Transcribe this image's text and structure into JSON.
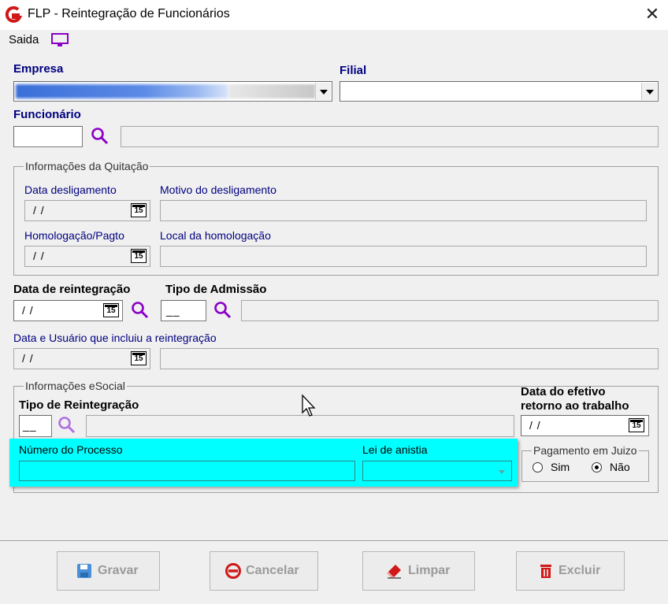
{
  "window": {
    "title": "FLP - Reintegração de Funcionários",
    "close_label": "✕"
  },
  "menu": {
    "saida_label": "Saida",
    "monitor_icon": "monitor-icon"
  },
  "empresa": {
    "label": "Empresa",
    "value": ""
  },
  "filial": {
    "label": "Filial",
    "value": ""
  },
  "funcionario": {
    "label": "Funcionário",
    "code": "",
    "name": ""
  },
  "quitacao": {
    "legend": "Informações da Quitação",
    "data_desligamento_label": "Data desligamento",
    "data_desligamento_value": "/ /",
    "motivo_label": "Motivo do desligamento",
    "motivo_value": "",
    "homologacao_label": "Homologação/Pagto",
    "homologacao_value": "/ /",
    "local_label": "Local da homologação",
    "local_value": ""
  },
  "reintegracao": {
    "data_label": "Data de reintegração",
    "data_value": "/ /",
    "tipo_admissao_label": "Tipo de Admissão",
    "tipo_admissao_code": "__",
    "tipo_admissao_desc": ""
  },
  "inclusao": {
    "label": "Data e Usuário que incluiu a reintegração",
    "date_value": "/ /",
    "user_value": ""
  },
  "esocial": {
    "legend": "Informações eSocial",
    "tipo_label": "Tipo de Reintegração",
    "tipo_code": "__",
    "tipo_desc": "",
    "processo_label": "Número do Processo",
    "processo_value": "",
    "lei_label": "Lei de anistia",
    "lei_value": "",
    "retorno_label_line1": "Data do efetivo",
    "retorno_label_line2": "retorno ao trabalho",
    "retorno_value": "/ /",
    "pagamento_legend": "Pagamento em Juizo",
    "sim_label": "Sim",
    "nao_label": "Não",
    "selected": "Não"
  },
  "calendar_glyph": "15",
  "buttons": {
    "gravar": "Gravar",
    "cancelar": "Cancelar",
    "limpar": "Limpar",
    "excluir": "Excluir"
  },
  "colors": {
    "accent_purple": "#8b00c8",
    "label_navy": "#000080",
    "highlight_cyan": "#00ffff",
    "logo_red": "#d01818"
  }
}
